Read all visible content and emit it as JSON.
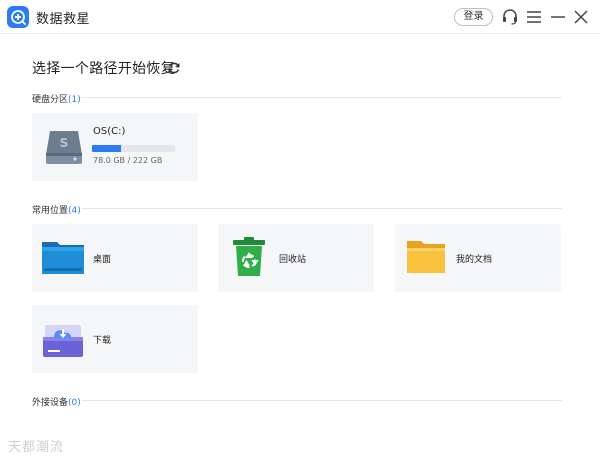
{
  "app": {
    "title": "数据救星",
    "login_label": "登录"
  },
  "main": {
    "heading": "选择一个路径开始恢复",
    "sections": {
      "disks": {
        "label": "硬盘分区",
        "count": "(1)"
      },
      "common": {
        "label": "常用位置",
        "count": "(4)"
      },
      "external": {
        "label": "外接设备",
        "count": "(0)"
      }
    },
    "drive": {
      "name": "OS(C:)",
      "size": "78.0 GB / 222 GB",
      "used_percent": 35.1
    },
    "locations": {
      "desktop": "桌面",
      "recycle": "回收站",
      "documents": "我的文档",
      "downloads": "下载"
    }
  },
  "watermark": "天都潮流",
  "colors": {
    "accent": "#2d7bf4",
    "card_bg": "#f5f6f8",
    "folder": "#f9b82a",
    "recycle": "#2fae4a"
  },
  "icons": [
    "app-logo-icon",
    "headset-icon",
    "menu-icon",
    "minimize-icon",
    "close-icon",
    "refresh-icon",
    "hard-drive-icon",
    "desktop-folder-icon",
    "recycle-bin-icon",
    "documents-folder-icon",
    "downloads-folder-icon"
  ]
}
